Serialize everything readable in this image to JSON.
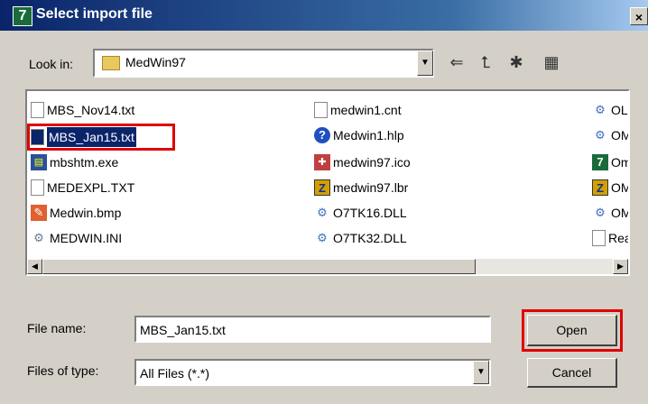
{
  "window": {
    "title": "Select import file",
    "app_icon_glyph": "7",
    "close_glyph": "×"
  },
  "lookin": {
    "label": "Look in:",
    "value": "MedWin97"
  },
  "files": [
    {
      "name": "MBS_Nov14.txt",
      "icon": "text-file-icon",
      "selected": false
    },
    {
      "name": "MBS_Jan15.txt",
      "icon": "text-file-icon",
      "selected": true
    },
    {
      "name": "mbshtm.exe",
      "icon": "exe-icon",
      "selected": false
    },
    {
      "name": "MEDEXPL.TXT",
      "icon": "text-file-icon",
      "selected": false
    },
    {
      "name": "Medwin.bmp",
      "icon": "bitmap-icon",
      "selected": false
    },
    {
      "name": "MEDWIN.INI",
      "icon": "settings-file-icon",
      "selected": false
    },
    {
      "name": "medwin1.cnt",
      "icon": "text-file-icon",
      "selected": false
    },
    {
      "name": "Medwin1.hlp",
      "icon": "help-icon",
      "selected": false
    },
    {
      "name": "medwin97.ico",
      "icon": "icon-file-icon",
      "selected": false
    },
    {
      "name": "medwin97.lbr",
      "icon": "library-icon",
      "selected": false
    },
    {
      "name": "O7TK16.DLL",
      "icon": "dll-icon",
      "selected": false
    },
    {
      "name": "O7TK32.DLL",
      "icon": "dll-icon",
      "selected": false
    },
    {
      "name": "OLE",
      "icon": "dll-icon",
      "selected": false
    },
    {
      "name": "OMI",
      "icon": "dll-icon",
      "selected": false
    },
    {
      "name": "Omr",
      "icon": "app-7-icon",
      "selected": false
    },
    {
      "name": "OMI",
      "icon": "library-icon",
      "selected": false
    },
    {
      "name": "OMI",
      "icon": "dll-icon",
      "selected": false
    },
    {
      "name": "Rea",
      "icon": "text-file-icon",
      "selected": false
    }
  ],
  "filename": {
    "label": "File name:",
    "value": "MBS_Jan15.txt"
  },
  "filetype": {
    "label": "Files of type:",
    "value": "All Files (*.*)"
  },
  "buttons": {
    "open": "Open",
    "cancel": "Cancel"
  },
  "glyphs": {
    "dropdown": "▼",
    "back": "⇐",
    "up_folder": "⮤",
    "new_folder": "✱",
    "view_menu": "▦",
    "scroll_left": "◀",
    "scroll_right": "▶"
  },
  "colors": {
    "selection": "#0a246a",
    "annotation": "#e00000"
  }
}
